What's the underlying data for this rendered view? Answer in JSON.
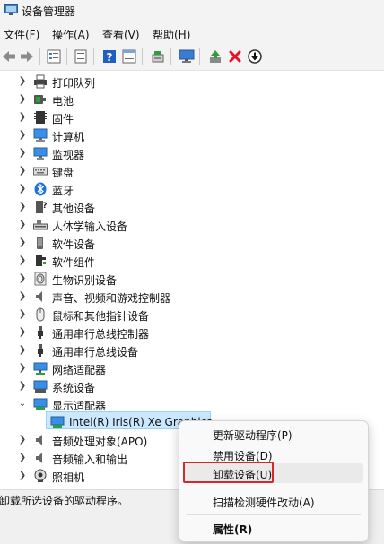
{
  "window": {
    "title": "设备管理器"
  },
  "menu": [
    "文件(F)",
    "操作(A)",
    "查看(V)",
    "帮助(H)"
  ],
  "toolbar": {
    "buttons": [
      "back-arrow-icon",
      "forward-arrow-icon",
      "tree-view-icon",
      "properties-icon",
      "help-icon",
      "details-view-icon",
      "scan-icon",
      "monitor-icon",
      "update-driver-icon",
      "uninstall-x-icon",
      "disable-icon"
    ],
    "colors": {
      "uninstall": "#e81123",
      "help": "#1f5fbf",
      "update": "#2aa03a"
    }
  },
  "tree": {
    "items": [
      {
        "label": "打印队列",
        "icon": "printer-icon",
        "expanded": false
      },
      {
        "label": "电池",
        "icon": "battery-icon",
        "expanded": false
      },
      {
        "label": "固件",
        "icon": "firmware-icon",
        "expanded": false
      },
      {
        "label": "计算机",
        "icon": "computer-icon",
        "expanded": false
      },
      {
        "label": "监视器",
        "icon": "monitor-icon",
        "expanded": false
      },
      {
        "label": "键盘",
        "icon": "keyboard-icon",
        "expanded": false
      },
      {
        "label": "蓝牙",
        "icon": "bluetooth-icon",
        "expanded": false
      },
      {
        "label": "其他设备",
        "icon": "unknown-device-icon",
        "expanded": false
      },
      {
        "label": "人体学输入设备",
        "icon": "hid-icon",
        "expanded": false
      },
      {
        "label": "软件设备",
        "icon": "software-device-icon",
        "expanded": false
      },
      {
        "label": "软件组件",
        "icon": "software-component-icon",
        "expanded": false
      },
      {
        "label": "生物识别设备",
        "icon": "fingerprint-icon",
        "expanded": false
      },
      {
        "label": "声音、视频和游戏控制器",
        "icon": "speaker-icon",
        "expanded": false
      },
      {
        "label": "鼠标和其他指针设备",
        "icon": "mouse-icon",
        "expanded": false
      },
      {
        "label": "通用串行总线控制器",
        "icon": "usb-icon",
        "expanded": false
      },
      {
        "label": "通用串行总线设备",
        "icon": "usb-icon",
        "expanded": false
      },
      {
        "label": "网络适配器",
        "icon": "network-icon",
        "expanded": false
      },
      {
        "label": "系统设备",
        "icon": "system-icon",
        "expanded": false
      },
      {
        "label": "显示适配器",
        "icon": "display-adapter-icon",
        "expanded": true
      },
      {
        "label": "Intel(R) Iris(R) Xe Graphics",
        "icon": "display-adapter-icon",
        "child": true,
        "selected": true
      },
      {
        "label": "音频处理对象(APO)",
        "icon": "speaker-icon",
        "expanded": false
      },
      {
        "label": "音频输入和输出",
        "icon": "speaker-icon",
        "expanded": false
      },
      {
        "label": "照相机",
        "icon": "camera-icon",
        "expanded": false
      }
    ],
    "selection_color": "#cce8ff"
  },
  "context_menu": {
    "items": [
      {
        "label": "更新驱动程序(P)"
      },
      {
        "label": "禁用设备(D)"
      },
      {
        "label": "卸载设备(U)",
        "highlighted": true
      },
      {
        "label": "扫描检测硬件改动(A)"
      },
      {
        "label": "属性(R)",
        "bold": true
      }
    ],
    "highlight_box_color": "#d62828"
  },
  "status": {
    "text": "卸载所选设备的驱动程序。"
  }
}
